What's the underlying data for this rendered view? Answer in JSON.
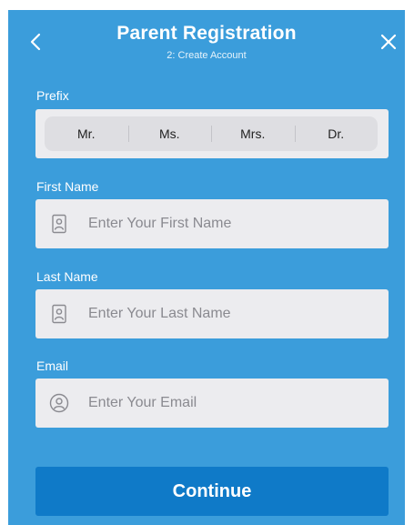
{
  "header": {
    "title": "Parent Registration",
    "subtitle": "2: Create Account",
    "back_icon": "chevron-left-icon",
    "close_icon": "close-icon"
  },
  "prefix": {
    "label": "Prefix",
    "options": [
      "Mr.",
      "Ms.",
      "Mrs.",
      "Dr."
    ]
  },
  "first_name": {
    "label": "First Name",
    "placeholder": "Enter Your First Name",
    "icon": "id-card-icon"
  },
  "last_name": {
    "label": "Last Name",
    "placeholder": "Enter Your Last Name",
    "icon": "id-card-icon"
  },
  "email": {
    "label": "Email",
    "placeholder": "Enter Your Email",
    "icon": "user-circle-icon"
  },
  "continue_label": "Continue",
  "colors": {
    "background": "#3b9ddb",
    "button": "#0f7ac8",
    "field": "#ececef"
  }
}
